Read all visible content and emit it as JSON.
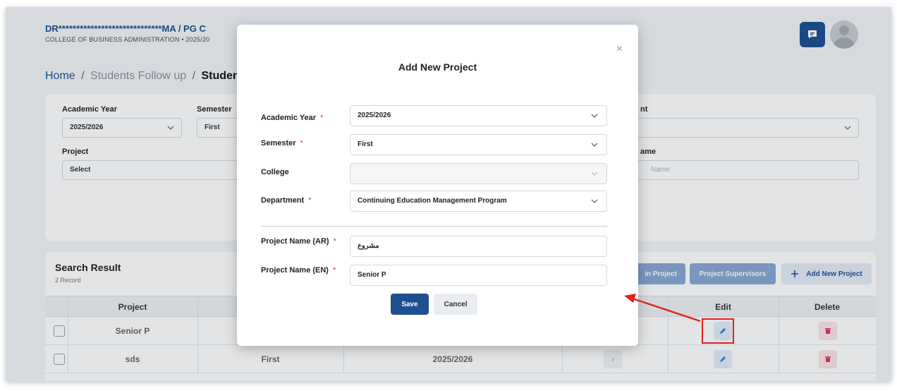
{
  "header": {
    "user_name": "DR*****************************MA / PG C",
    "college_line": "COLLEGE OF BUSINESS ADMINISTRATION   •  2025/20"
  },
  "breadcrumb": {
    "home": "Home",
    "sep": "/",
    "follow_up": "Students Follow up",
    "current": "Students"
  },
  "filters": {
    "academic_year_label": "Academic Year",
    "academic_year_value": "2025/2026",
    "semester_label": "Semester",
    "semester_value": "First",
    "project_label": "Project",
    "project_value": "Select",
    "right_label_1": "nt",
    "right_label_2": "ame",
    "right_placeholder_2": "Name"
  },
  "results": {
    "title": "Search Result",
    "count": "2 Record",
    "join_button": "in Project",
    "supervisors_button": "Project Supervisors",
    "add_button": "Add New Project",
    "columns": {
      "project": "Project",
      "edit": "Edit",
      "delete": "Delete"
    },
    "rows": [
      {
        "project": "Senior P",
        "semester": "",
        "year": ""
      },
      {
        "project": "sds",
        "semester": "First",
        "year": "2025/2026",
        "arrow": "›"
      }
    ]
  },
  "modal": {
    "title": "Add New Project",
    "close_glyph": "×",
    "required_mark": "*",
    "fields": {
      "academic_year_label": "Academic Year",
      "academic_year_value": "2025/2026",
      "semester_label": "Semester",
      "semester_value": "First",
      "college_label": "College",
      "college_value": "",
      "department_label": "Department",
      "department_value": "Continuing Education Management Program",
      "name_ar_label": "Project Name (AR)",
      "name_ar_value": "مشروع",
      "name_en_label": "Project Name (EN)",
      "name_en_value": "Senior P"
    },
    "save": "Save",
    "cancel": "Cancel"
  },
  "colors": {
    "primary": "#1d4f91",
    "required": "#e0343f",
    "highlight": "#e02020",
    "delete_icon": "#e0345a",
    "edit_icon": "#2f7fd6"
  }
}
